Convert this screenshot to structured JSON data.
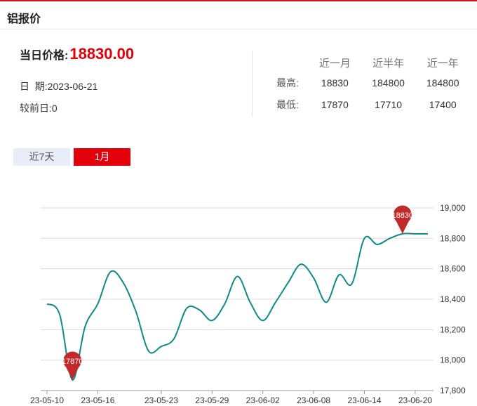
{
  "header": {
    "title": "铝报价"
  },
  "today": {
    "label": "当日价格:",
    "price": "18830.00"
  },
  "info": {
    "date_label": "日  期:",
    "date_value": "2023-06-21",
    "change_label": "较前日:",
    "change_value": "0"
  },
  "stats": {
    "columns": [
      "近一月",
      "近半年",
      "近一年"
    ],
    "rows": [
      {
        "label": "最高:",
        "values": [
          "18830",
          "184800",
          "184800"
        ]
      },
      {
        "label": "最低:",
        "values": [
          "17870",
          "17710",
          "17400"
        ]
      }
    ]
  },
  "tabs": [
    {
      "label": "近7天",
      "active": false
    },
    {
      "label": "1月",
      "active": true
    }
  ],
  "chart_data": {
    "type": "line",
    "title": "",
    "xlabel": "",
    "ylabel": "",
    "ylim": [
      17800,
      19000
    ],
    "yticks": [
      17800,
      18000,
      18200,
      18400,
      18600,
      18800,
      19000
    ],
    "ytick_labels": [
      "17,800",
      "18,000",
      "18,200",
      "18,400",
      "18,600",
      "18,800",
      "19,000"
    ],
    "xtick_labels": [
      "23-05-10",
      "23-05-16",
      "23-05-23",
      "23-05-29",
      "23-06-02",
      "23-06-08",
      "23-06-14",
      "23-06-20"
    ],
    "line_color": "#0e8a8a",
    "marker_color": "#c12a2a",
    "grid": true,
    "series": [
      {
        "name": "",
        "x": [
          "05-10",
          "05-11",
          "05-12",
          "05-15",
          "05-16",
          "05-17",
          "05-18",
          "05-19",
          "05-22",
          "05-23",
          "05-24",
          "05-25",
          "05-26",
          "05-29",
          "05-30",
          "05-31",
          "06-01",
          "06-02",
          "06-05",
          "06-06",
          "06-07",
          "06-08",
          "06-09",
          "06-12",
          "06-13",
          "06-14",
          "06-15",
          "06-16",
          "06-19",
          "06-20",
          "06-21"
        ],
        "values": [
          18370,
          18300,
          17870,
          18220,
          18370,
          18580,
          18510,
          18320,
          18060,
          18090,
          18140,
          18340,
          18330,
          18260,
          18370,
          18550,
          18380,
          18260,
          18380,
          18510,
          18630,
          18540,
          18380,
          18560,
          18500,
          18800,
          18760,
          18800,
          18830,
          18830,
          18830
        ]
      }
    ],
    "annotations": [
      {
        "label": "17870",
        "x": "05-12",
        "value": 17870
      },
      {
        "label": "18830",
        "x": "06-19",
        "value": 18830
      }
    ]
  }
}
